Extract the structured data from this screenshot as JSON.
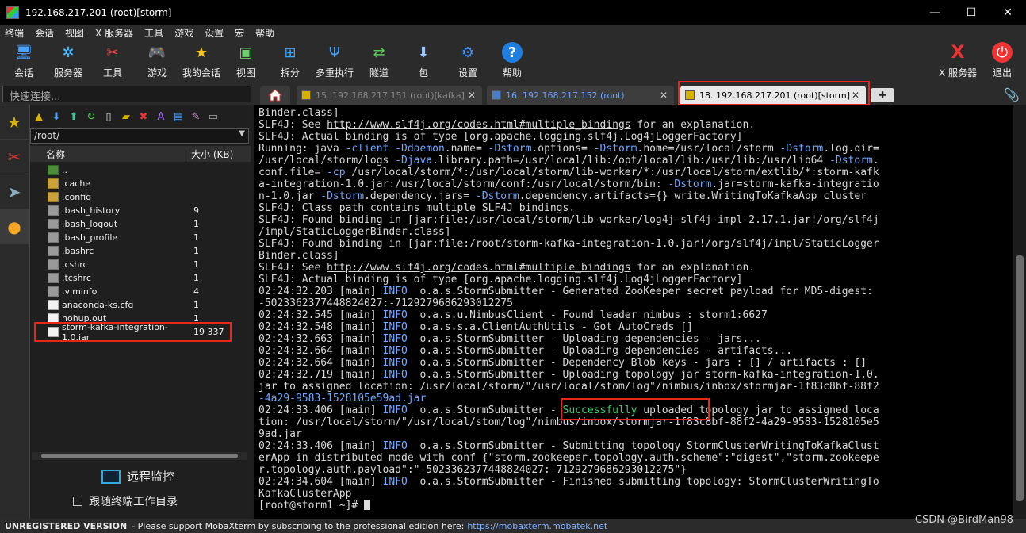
{
  "window": {
    "title": "192.168.217.201 (root)[storm]",
    "min": "—",
    "max": "☐",
    "close": "✕"
  },
  "menu": [
    "终端",
    "会话",
    "视图",
    "X 服务器",
    "工具",
    "游戏",
    "设置",
    "宏",
    "帮助"
  ],
  "toolbar": {
    "session": "会话",
    "servers": "服务器",
    "tools": "工具",
    "games": "游戏",
    "sessions": "我的会话",
    "view": "视图",
    "split": "拆分",
    "multiexec": "多重执行",
    "tunnel": "隧道",
    "packages": "包",
    "settings": "设置",
    "help": "帮助",
    "xserver": "X 服务器",
    "exit": "退出"
  },
  "quick_connect": {
    "placeholder": "快速连接..."
  },
  "tabs": [
    {
      "label": "15. 192.168.217.151 (root)[kafka]",
      "close": "✕"
    },
    {
      "label": "16. 192.168.217.152 (root)",
      "close": "✕"
    },
    {
      "label": "18. 192.168.217.201 (root)[storm]",
      "close": "✕"
    }
  ],
  "filepanel": {
    "path": "/root/",
    "col_name": "名称",
    "col_size": "大小 (KB)",
    "files": [
      {
        "name": "..",
        "size": ""
      },
      {
        "name": ".cache",
        "size": ""
      },
      {
        "name": ".config",
        "size": ""
      },
      {
        "name": ".bash_history",
        "size": "9"
      },
      {
        "name": ".bash_logout",
        "size": "1"
      },
      {
        "name": ".bash_profile",
        "size": "1"
      },
      {
        "name": ".bashrc",
        "size": "1"
      },
      {
        "name": ".cshrc",
        "size": "1"
      },
      {
        "name": ".tcshrc",
        "size": "1"
      },
      {
        "name": ".viminfo",
        "size": "4"
      },
      {
        "name": "anaconda-ks.cfg",
        "size": "1"
      },
      {
        "name": "nohup.out",
        "size": "1"
      },
      {
        "name": "storm-kafka-integration-1.0.jar",
        "size": "19 337"
      }
    ],
    "monitor_label": "远程监控",
    "follow_label": "跟随终端工作目录"
  },
  "terminal": {
    "l01": "Binder.class]",
    "l02a": "SLF4J: See ",
    "l02b": "http://www.slf4j.org/codes.html#multiple_bindings",
    "l02c": " for an explanation.",
    "l03": "SLF4J: Actual binding is of type [org.apache.logging.slf4j.Log4jLoggerFactory]",
    "l04a": "Running: java ",
    "l04b": "-client",
    "l04c": " ",
    "l04d": "-Ddaemon",
    "l04e": ".name= ",
    "l04f": "-Dstorm",
    "l04g": ".options= ",
    "l04h": "-Dstorm",
    "l04i": ".home=/usr/local/storm ",
    "l04j": "-Dstorm",
    "l04k": ".log.dir=",
    "l05a": "/usr/local/storm/logs ",
    "l05b": "-Djava",
    "l05c": ".library.path=/usr/local/lib:/opt/local/lib:/usr/lib:/usr/lib64 ",
    "l05d": "-Dstorm",
    "l06a": "conf.file= ",
    "l06b": "-cp",
    "l06c": " /usr/local/storm/*:/usr/local/storm/lib-worker/*:/usr/local/storm/extlib/*:storm-kafk",
    "l07a": "a-integration-1.0.jar:/usr/local/storm/conf:/usr/local/storm/bin: ",
    "l07b": "-Dstorm",
    "l07c": ".jar=storm-kafka-integratio",
    "l08a": "n-1.0.jar ",
    "l08b": "-Dstorm",
    "l08c": ".dependency.jars= ",
    "l08d": "-Dstorm",
    "l08e": ".dependency.artifacts={} write.WritingToKafkaApp cluster",
    "l09": "SLF4J: Class path contains multiple SLF4J bindings.",
    "l10": "SLF4J: Found binding in [jar:file:/usr/local/storm/lib-worker/log4j-slf4j-impl-2.17.1.jar!/org/slf4j",
    "l11": "/impl/StaticLoggerBinder.class]",
    "l12": "SLF4J: Found binding in [jar:file:/root/storm-kafka-integration-1.0.jar!/org/slf4j/impl/StaticLogger",
    "l13": "Binder.class]",
    "l14a": "SLF4J: See ",
    "l14b": "http://www.slf4j.org/codes.html#multiple_bindings",
    "l14c": " for an explanation.",
    "l15": "SLF4J: Actual binding is of type [org.apache.logging.slf4j.Log4jLoggerFactory]",
    "l16a": "02:24:32.203 [main] ",
    "l16b": "INFO",
    "l16c": "  o.a.s.StormSubmitter - Generated ZooKeeper secret payload for MD5-digest:",
    "l17": "-5023362377448824027:-7129279686293012275",
    "l18a": "02:24:32.545 [main] ",
    "l18b": "INFO",
    "l18c": "  o.a.s.u.NimbusClient - Found leader nimbus : storm1:6627",
    "l19a": "02:24:32.548 [main] ",
    "l19b": "INFO",
    "l19c": "  o.a.s.s.a.ClientAuthUtils - Got AutoCreds []",
    "l20a": "02:24:32.663 [main] ",
    "l20b": "INFO",
    "l20c": "  o.a.s.StormSubmitter - Uploading dependencies - jars...",
    "l21a": "02:24:32.664 [main] ",
    "l21b": "INFO",
    "l21c": "  o.a.s.StormSubmitter - Uploading dependencies - artifacts...",
    "l22a": "02:24:32.664 [main] ",
    "l22b": "INFO",
    "l22c": "  o.a.s.StormSubmitter - Dependency Blob keys - jars : [] / artifacts : []",
    "l23a": "02:24:32.719 [main] ",
    "l23b": "INFO",
    "l23c": "  o.a.s.StormSubmitter - Uploading topology jar storm-kafka-integration-1.0.",
    "l24": "jar to assigned location: /usr/local/storm/\"/usr/local/stom/log\"/nimbus/inbox/stormjar-1f83c8bf-88f2",
    "l25": "-4a29-9583-1528105e59ad.jar",
    "l26a": "02:24:33.406 [main] ",
    "l26b": "INFO",
    "l26c": "  o.a.s.StormSubmitter - ",
    "l26d": "Successfully",
    "l26e": " uploaded topology jar to assigned loca",
    "l27": "tion: /usr/local/storm/\"/usr/local/stom/log\"/nimbus/inbox/stormjar-1f83c8bf-88f2-4a29-9583-1528105e5",
    "l28": "9ad.jar",
    "l29a": "02:24:33.406 [main] ",
    "l29b": "INFO",
    "l29c": "  o.a.s.StormSubmitter - Submitting topology StormClusterWritingToKafkaClust",
    "l30": "erApp in distributed mode with conf {\"storm.zookeeper.topology.auth.scheme\":\"digest\",\"storm.zookeepe",
    "l31": "r.topology.auth.payload\":\"-5023362377448824027:-7129279686293012275\"}",
    "l32a": "02:24:34.604 [main] ",
    "l32b": "INFO",
    "l32c": "  o.a.s.StormSubmitter - Finished submitting topology: StormClusterWritingTo",
    "l33": "KafkaClusterApp",
    "prompt": "[root@storm1 ~]# "
  },
  "status": {
    "unregistered": "UNREGISTERED VERSION",
    "message": "-  Please support MobaXterm by subscribing to the professional edition here:",
    "link": "https://mobaxterm.mobatek.net"
  },
  "watermark": "CSDN @BirdMan98",
  "colors": {
    "highlight": "#e8261a",
    "info": "#6fa8ff",
    "success": "#2fd36a"
  }
}
